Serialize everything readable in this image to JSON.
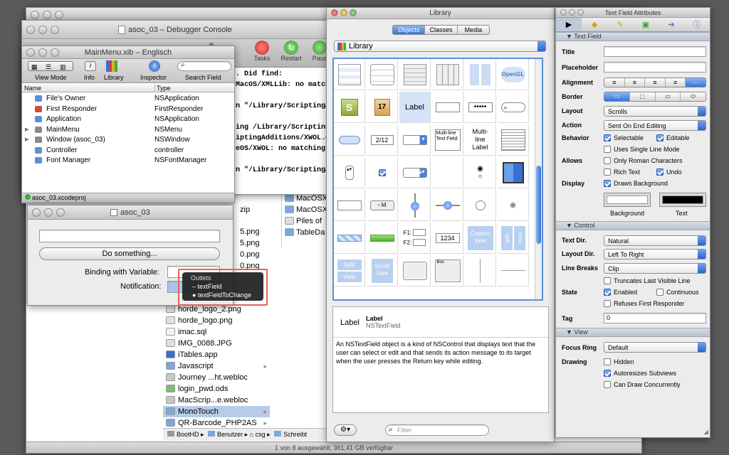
{
  "finder": {
    "items": [
      {
        "name": "horde_logo_2.png",
        "icon": "image-file-icon"
      },
      {
        "name": "horde_logo.png",
        "icon": "image-file-icon"
      },
      {
        "name": "imac.sql",
        "icon": "document-file-icon"
      },
      {
        "name": "IMG_0088.JPG",
        "icon": "image-file-icon"
      },
      {
        "name": "iTables.app",
        "icon": "app-icon"
      },
      {
        "name": "Javascript",
        "icon": "folder-icon"
      },
      {
        "name": "Journey ...ht.webloc",
        "icon": "webloc-icon"
      },
      {
        "name": "login_pwd.ods",
        "icon": "spreadsheet-icon"
      },
      {
        "name": "MacScrip...e.webloc",
        "icon": "webloc-icon"
      },
      {
        "name": "MonoTouch",
        "icon": "folder-icon"
      },
      {
        "name": "QR-Barcode_PHP2AS",
        "icon": "folder-icon"
      }
    ],
    "col_a": [
      "zip",
      "5.png",
      "5.png",
      "0.png",
      "0.png"
    ],
    "col_b": [
      "MacOSX",
      "MacOSX",
      "Piles of",
      "TableDa"
    ],
    "path": [
      "BootHD",
      "Benutzer",
      "csg",
      "Schreibt"
    ],
    "status": "1 von 8 ausgewählt, 361,41 GB verfügbar"
  },
  "debugger": {
    "title": "asoc_03 – Debugger Console",
    "toolbar": [
      "Tasks",
      "Restart",
      "Paus"
    ],
    "lines": [
      ". Did find:",
      "MacOS/XMLLib: no matchin",
      "",
      "n \"/Library/ScriptingAd",
      "",
      "ing /Library/ScriptingA",
      "iptingAdditions/XWOL.osa",
      "eOS/XWOL: no matching a",
      "",
      "n \"/Library/ScriptingAd"
    ]
  },
  "mainmenu": {
    "title": "MainMenu.xib – Englisch",
    "toolbar": [
      "View Mode",
      "Info",
      "Library",
      "Inspector",
      "Search Field"
    ],
    "columns": [
      "Name",
      "Type"
    ],
    "rows": [
      {
        "name": "File's Owner",
        "type": "NSApplication",
        "icon": "cube-icon",
        "color": "#5b8fd8"
      },
      {
        "name": "First Responder",
        "type": "FirstResponder",
        "icon": "cube-red-icon",
        "color": "#d24a3a"
      },
      {
        "name": "Application",
        "type": "NSApplication",
        "icon": "cube-icon",
        "color": "#5b8fd8"
      },
      {
        "name": "MainMenu",
        "type": "NSMenu",
        "icon": "menu-icon",
        "color": "#8a8a8a"
      },
      {
        "name": "Window (asoc_03)",
        "type": "NSWindow",
        "icon": "window-icon",
        "color": "#8a8a8a"
      },
      {
        "name": "Controller",
        "type": "controller",
        "icon": "cube-icon",
        "color": "#5b8fd8"
      },
      {
        "name": "Font Manager",
        "type": "NSFontManager",
        "icon": "cube-icon",
        "color": "#5b8fd8"
      }
    ],
    "status": "asoc_03.xcodeproj"
  },
  "appwin": {
    "title": "asoc_03",
    "button": "Do something...",
    "binding_label": "Binding with Variable:",
    "notification_label": "Notification:",
    "outlets_title": "Outlets",
    "outlets": [
      "textField",
      "textFieldToChange"
    ]
  },
  "library": {
    "title": "Library",
    "tabs": [
      "Objects",
      "Classes",
      "Media"
    ],
    "popup": "Library",
    "grid_texts": {
      "label": "Label",
      "multi1": "Multi-line Text Field",
      "multi2": "Multi-line Label",
      "stepper": "2/12",
      "secure": "•••••",
      "f1": "F1:",
      "f2": "F2:",
      "num": "1234",
      "custom": "Custom View",
      "split": "Split",
      "view": "View",
      "box": "Box",
      "opengl": "OpenGL",
      "m": "M"
    },
    "detail_name": "Label",
    "detail_title": "Label",
    "detail_class": "NSTextField",
    "detail_icon_text": "Label",
    "description": "An NSTextField object is a kind of NSControl that displays text that the user can select or edit and that sends its action message to its target when the user presses the Return key while editing.",
    "filter_placeholder": "Filter"
  },
  "inspector": {
    "title": "Text Field Attributes",
    "sections": {
      "textfield": "Text Field",
      "control": "Control",
      "view": "View"
    },
    "labels": {
      "title": "Title",
      "placeholder": "Placeholder",
      "alignment": "Alignment",
      "border": "Border",
      "layout": "Layout",
      "action": "Action",
      "behavior": "Behavior",
      "allows": "Allows",
      "display": "Display",
      "textdir": "Text Dir.",
      "layoutdir": "Layout Dir.",
      "linebreaks": "Line Breaks",
      "state": "State",
      "tag": "Tag",
      "focusring": "Focus Ring",
      "drawing": "Drawing"
    },
    "values": {
      "layout": "Scrolls",
      "action": "Sent On End Editing",
      "textdir": "Natural",
      "layoutdir": "Left To Right",
      "linebreaks": "Clip",
      "tag": "0",
      "focusring": "Default"
    },
    "checks": {
      "selectable": "Selectable",
      "editable": "Editable",
      "single_line": "Uses Single Line Mode",
      "roman": "Only Roman Characters",
      "rich": "Rich Text",
      "undo": "Undo",
      "draws_bg": "Draws Background",
      "truncates": "Truncates Last Visible Line",
      "enabled": "Enabled",
      "continuous": "Continuous",
      "refuses": "Refuses First Responder",
      "hidden": "Hidden",
      "autoresizes": "Autoresizes Subviews",
      "concurrent": "Can Draw Concurrently"
    },
    "background_label": "Background",
    "text_label": "Text",
    "colors": {
      "background": "#ffffff",
      "text": "#000000"
    }
  }
}
